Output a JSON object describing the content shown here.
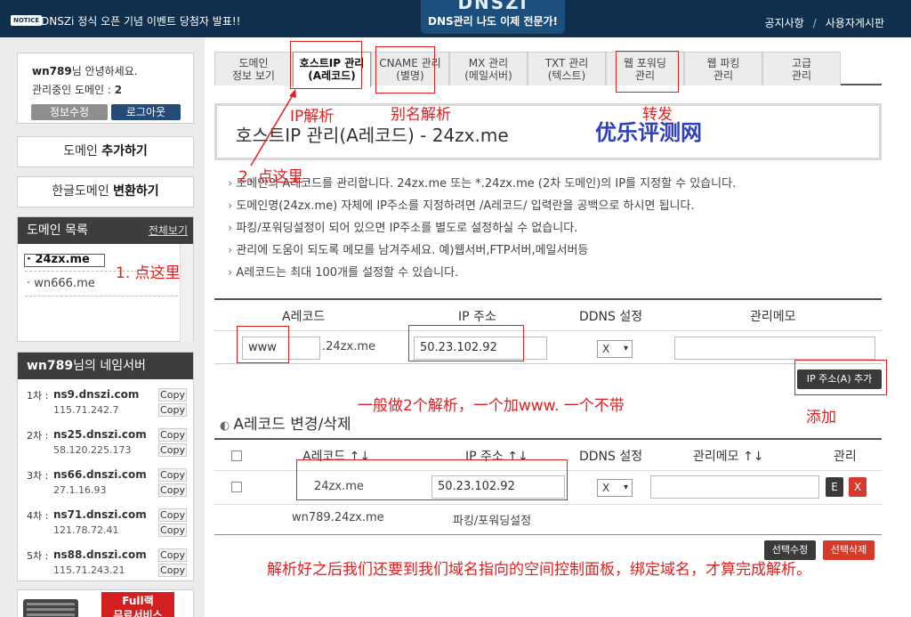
{
  "header": {
    "notice_badge": "NOTICE",
    "notice_text": "DNSZi 정식 오픈 기념 이벤트 당첨자 발표!!",
    "logo": "DNSZi",
    "slogan": "DNS관리 나도 이제 전문가!",
    "links": [
      "공지사항",
      "사용자게시판"
    ],
    "separator": "/"
  },
  "login": {
    "user": "wn789",
    "greeting_suffix": "님 안녕하세요.",
    "domain_count_label": "관리중인 도메인 : ",
    "domain_count": "2",
    "info_button": "정보수정",
    "logout_button": "로그아웃"
  },
  "menu": {
    "add_prefix": "도메인 ",
    "add_bold": "추가하기",
    "hangul_prefix": "한글도메인 ",
    "hangul_bold": "변환하기"
  },
  "domain_list": {
    "title": "도메인 목록",
    "view_all": "전체보기",
    "items": [
      "24zx.me",
      "wn666.me"
    ]
  },
  "nameservers": {
    "user": "wn789",
    "title_suffix": "님의 네임서버",
    "copy_label": "Copy",
    "entries": [
      {
        "label": "1차 :",
        "host": "ns9.dnszi.com",
        "ip": "115.71.242.7"
      },
      {
        "label": "2차 :",
        "host": "ns25.dnszi.com",
        "ip": "58.120.225.173"
      },
      {
        "label": "3차 :",
        "host": "ns66.dnszi.com",
        "ip": "27.1.16.93"
      },
      {
        "label": "4차 :",
        "host": "ns71.dnszi.com",
        "ip": "121.78.72.41"
      },
      {
        "label": "5차 :",
        "host": "ns88.dnszi.com",
        "ip": "115.71.243.21"
      }
    ]
  },
  "banner": {
    "text1": "Full랙",
    "text2": "무료서비스"
  },
  "tabs": [
    {
      "line1": "도메인",
      "line2": "정보 보기"
    },
    {
      "line1": "호스트IP 관리",
      "line2": "(A레코드)"
    },
    {
      "line1": "CNAME 관리",
      "line2": "(별명)"
    },
    {
      "line1": "MX 관리",
      "line2": "(메일서버)"
    },
    {
      "line1": "TXT 관리",
      "line2": "(텍스트)"
    },
    {
      "line1": "웹 포워딩",
      "line2": "관리"
    },
    {
      "line1": "웹 파킹",
      "line2": "관리"
    },
    {
      "line1": "고급",
      "line2": "관리"
    }
  ],
  "page_title": "호스트IP 관리(A레코드) - 24zx.me",
  "info_lines": [
    "도메인의 A레코드를 관리합니다. 24zx.me 또는 *.24zx.me (2차 도메인)의 IP를 지정할 수 있습니다.",
    "도메인명(24zx.me) 자체에 IP주소를 지정하려면 /A레코드/ 입력란을 공백으로 하시면 됩니다.",
    "파킹/포워딩설정이 되어 있으면 IP주소를 별도로 설정하실 수 없습니다.",
    "관리에 도움이 되도록 메모를 남겨주세요. 예)웹서버,FTP서버,메일서버등",
    "A레코드는 최대 100개를 설정할 수 있습니다."
  ],
  "add_form": {
    "headers": [
      "A레코드",
      "IP 주소",
      "DDNS 설정",
      "관리메모"
    ],
    "record_value": "www",
    "domain_suffix": ".24zx.me",
    "ip_value": "50.23.102.92",
    "ddns_value": "X",
    "memo_value": "",
    "add_button": "IP 주소(A) 추가"
  },
  "list_section": {
    "title": "A레코드 변경/삭제",
    "headers": [
      "A레코드 ↑↓",
      "IP 주소 ↑↓",
      "DDNS 설정",
      "관리메모 ↑↓",
      "관리"
    ],
    "row": {
      "record": "24zx.me",
      "ip": "50.23.102.92",
      "ddns": "X",
      "memo": "",
      "edit": "E",
      "delete": "X"
    },
    "parking_row": {
      "record": "wn789.24zx.me",
      "note": "파킹/포워딩설정"
    },
    "edit_selected": "선택수정",
    "delete_selected": "선택삭제"
  },
  "annotations": {
    "step1": "1. 点这里",
    "step2": "2. 点这里",
    "ip_resolve": "IP解析",
    "alias_resolve": "别名解析",
    "forward": "转发",
    "watermark": "优乐评测网",
    "two_records": "一般做2个解析，一个加www. 一个不带",
    "add": "添加",
    "footer_note": "解析好之后我们还要到我们域名指向的空间控制面板，绑定域名，才算完成解析。"
  },
  "colors": {
    "header_bg": "#0f2f4d",
    "annotation_red": "#e02020",
    "watermark_blue": "#2f3fbf",
    "delete_red": "#d63a2b"
  }
}
